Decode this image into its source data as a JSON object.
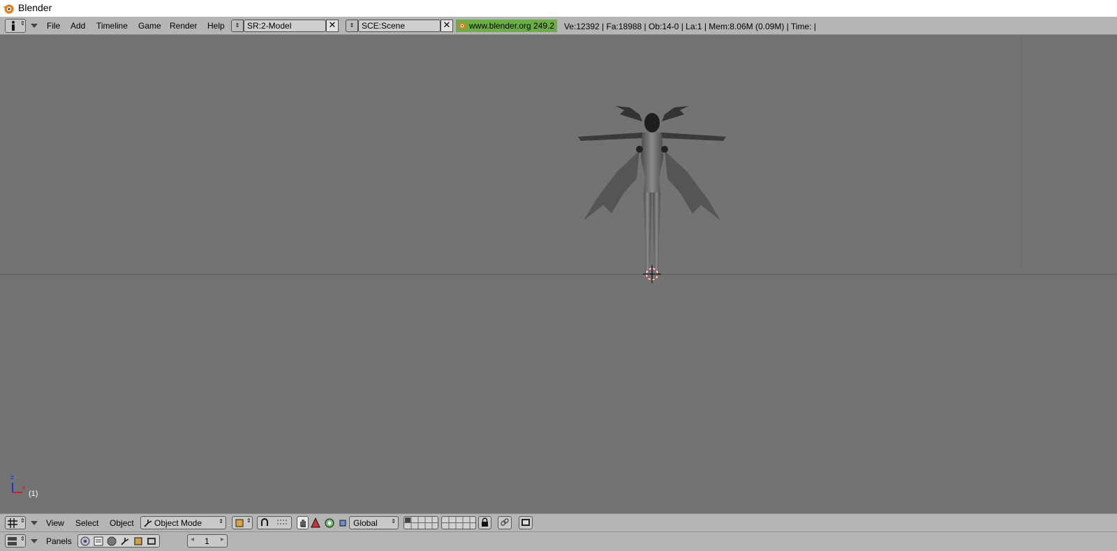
{
  "window": {
    "title": "Blender",
    "logo_icon": "blender-logo-icon"
  },
  "info_header": {
    "editor_icon": "info-icon",
    "menus": [
      "File",
      "Add",
      "Timeline",
      "Game",
      "Render",
      "Help"
    ],
    "screen_field": "SR:2-Model",
    "scene_field": "SCE:Scene",
    "website": "www.blender.org 249.2",
    "stats": "Ve:12392 | Fa:18988 | Ob:14-0 | La:1  | Mem:8.06M (0.09M)  | Time: |",
    "website_color": "#6cae46"
  },
  "viewport": {
    "frame_label": "(1)",
    "axis_z": "z",
    "axis_x": "x",
    "background_color": "#737373",
    "object_icon": "winged-character-model-icon"
  },
  "view3d_header": {
    "menus": [
      "View",
      "Select",
      "Object"
    ],
    "mode": "Object Mode",
    "orientation": "Global"
  },
  "buttons_header": {
    "panels_label": "Panels",
    "frame_value": "1"
  }
}
